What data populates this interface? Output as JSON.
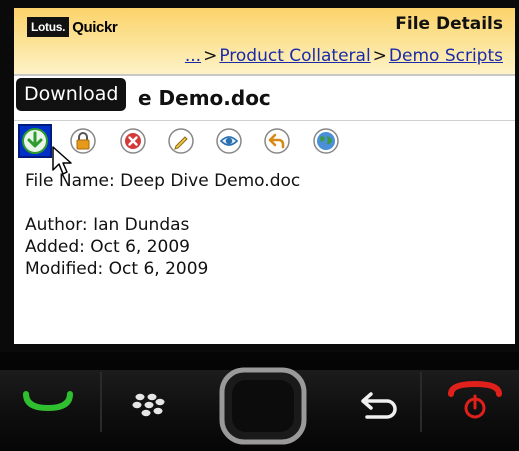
{
  "app": {
    "logo_brand": "Lotus.",
    "logo_product": "Quickr",
    "page_title": "File Details"
  },
  "breadcrumb": {
    "ellipsis": "...",
    "separator": ">",
    "items": [
      "Product Collateral",
      "Demo Scripts"
    ]
  },
  "document": {
    "title_visible": "e Demo.doc"
  },
  "tooltip": {
    "text": "Download"
  },
  "actions": [
    {
      "name": "download-icon",
      "color": "#2e9b2e",
      "selected": true
    },
    {
      "name": "lock-icon",
      "color": "#d98a14",
      "selected": false
    },
    {
      "name": "delete-icon",
      "color": "#d33a3a",
      "selected": false
    },
    {
      "name": "edit-icon",
      "color": "#b8860b",
      "selected": false
    },
    {
      "name": "view-icon",
      "color": "#2a6fb0",
      "selected": false
    },
    {
      "name": "reply-icon",
      "color": "#d98a14",
      "selected": false
    },
    {
      "name": "globe-icon",
      "color": "#3b8b3b",
      "selected": false
    }
  ],
  "details": {
    "file_name": "File Name: Deep Dive Demo.doc",
    "author": "Author: Ian Dundas",
    "added": "Added: Oct 6, 2009",
    "modified": "Modified: Oct 6, 2009"
  },
  "keypad": {
    "call_color": "#2fbf2f",
    "end_color": "#e0201a"
  }
}
